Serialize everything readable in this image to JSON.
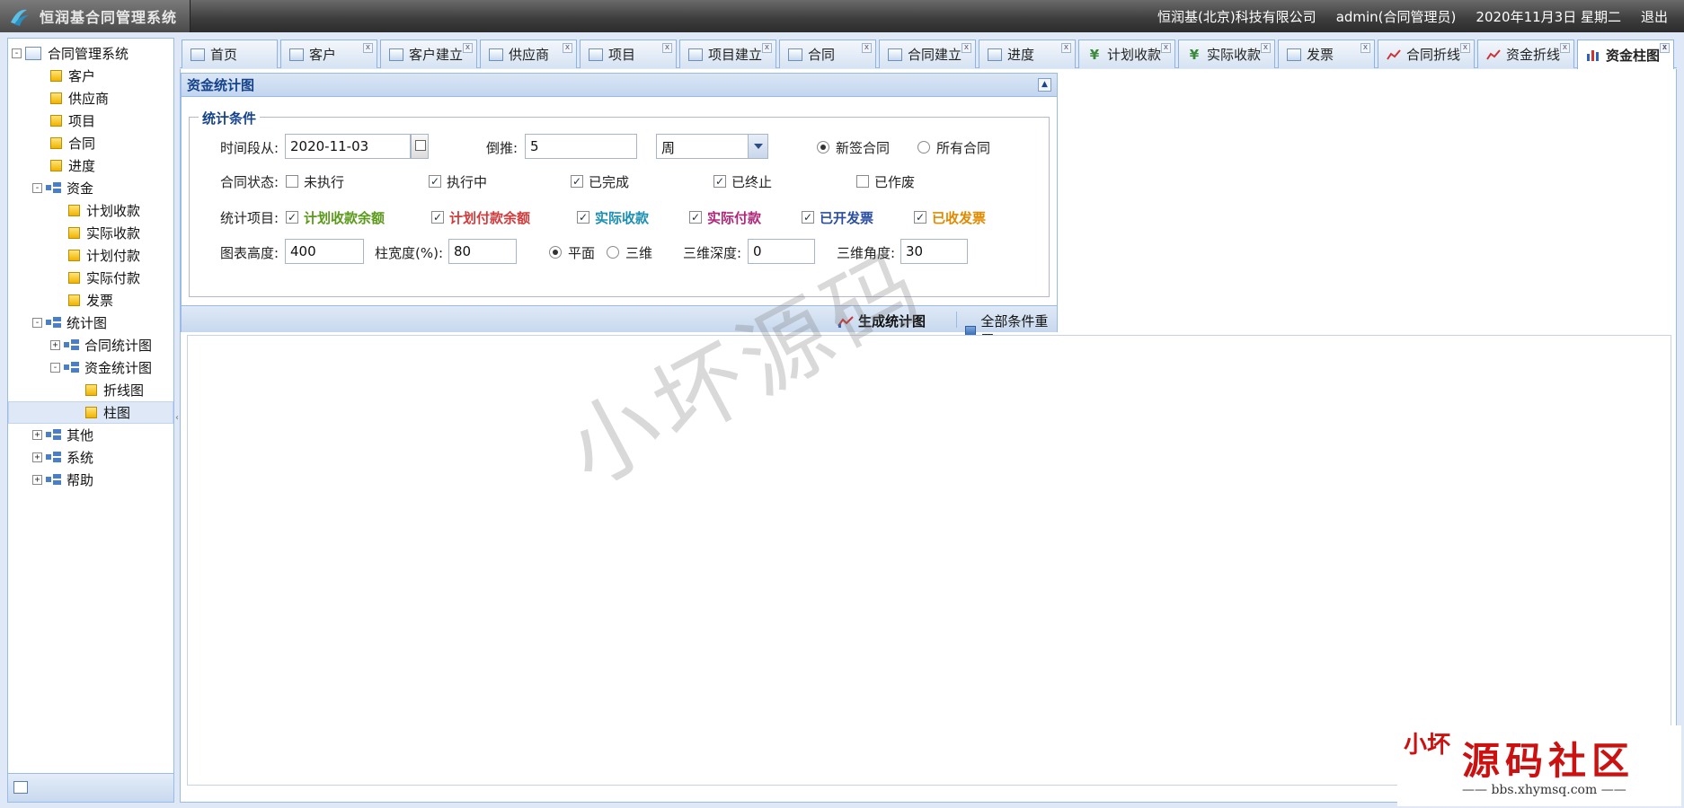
{
  "app": {
    "title": "恒润基合同管理系统",
    "company": "恒润基(北京)科技有限公司",
    "user": "admin(合同管理员)",
    "date": "2020年11月3日 星期二",
    "logout": "退出"
  },
  "tree": {
    "root": "合同管理系统",
    "customer": "客户",
    "supplier": "供应商",
    "project": "项目",
    "contract": "合同",
    "progress": "进度",
    "funds": "资金",
    "plan_receive": "计划收款",
    "actual_receive": "实际收款",
    "plan_pay": "计划付款",
    "actual_pay": "实际付款",
    "invoice": "发票",
    "stats": "统计图",
    "contract_stats": "合同统计图",
    "fund_stats": "资金统计图",
    "line_chart": "折线图",
    "bar_chart": "柱图",
    "other": "其他",
    "system": "系统",
    "help": "帮助"
  },
  "tabs": [
    {
      "label": "首页"
    },
    {
      "label": "客户"
    },
    {
      "label": "客户建立"
    },
    {
      "label": "供应商"
    },
    {
      "label": "项目"
    },
    {
      "label": "项目建立"
    },
    {
      "label": "合同"
    },
    {
      "label": "合同建立"
    },
    {
      "label": "进度"
    },
    {
      "label": "计划收款"
    },
    {
      "label": "实际收款"
    },
    {
      "label": "发票"
    },
    {
      "label": "合同折线"
    },
    {
      "label": "资金折线"
    },
    {
      "label": "资金柱图"
    }
  ],
  "panel": {
    "title": "资金统计图",
    "legend": "统计条件",
    "period_label": "时间段从:",
    "period_value": "2020-11-03",
    "back_label": "倒推:",
    "back_value": "5",
    "unit_value": "周",
    "new_contract": "新签合同",
    "all_contracts": "所有合同",
    "status_label": "合同状态:",
    "status": {
      "not_started": "未执行",
      "in_progress": "执行中",
      "completed": "已完成",
      "terminated": "已终止",
      "voided": "已作废"
    },
    "items_label": "统计项目:",
    "items": {
      "plan_receive_balance": "计划收款余额",
      "plan_pay_balance": "计划付款余额",
      "actual_receive": "实际收款",
      "actual_pay": "实际付款",
      "invoiced": "已开发票",
      "received_invoice": "已收发票"
    },
    "height_label": "图表高度:",
    "height_value": "400",
    "bar_width_label": "柱宽度(%):",
    "bar_width_value": "80",
    "flat": "平面",
    "three_d": "三维",
    "depth_label": "三维深度:",
    "depth_value": "0",
    "angle_label": "三维角度:",
    "angle_value": "30",
    "generate": "生成统计图",
    "reset": "全部条件重置"
  },
  "colors": {
    "item_plan_receive": "#5a9a1a",
    "item_plan_pay": "#d03a3a",
    "item_actual_receive": "#1b8fb2",
    "item_actual_pay": "#b0257a",
    "item_invoiced": "#2b4ea0",
    "item_received_invoice": "#e08a00"
  },
  "watermark": "小坏源码",
  "brandmark": {
    "seal": "小坏",
    "name": "源码社区",
    "url": "—— bbs.xhymsq.com ——"
  }
}
